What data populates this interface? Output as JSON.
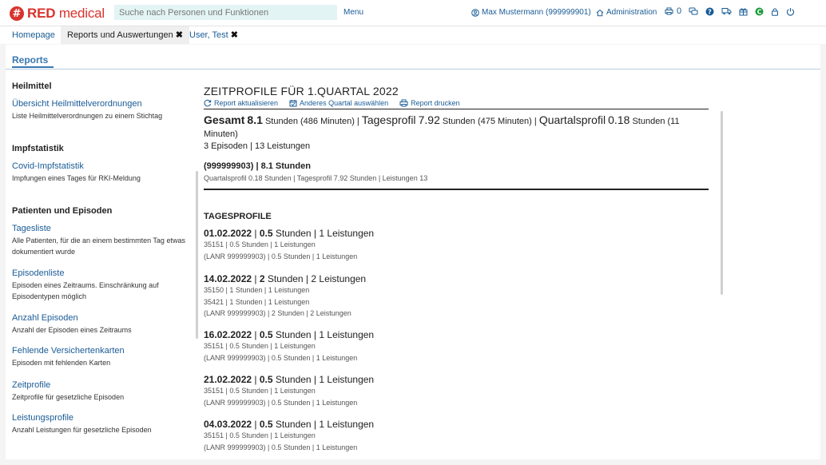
{
  "brand": {
    "mark": "#",
    "name_bold": "RED",
    "name_rest": " medical"
  },
  "topbar": {
    "search_placeholder": "Suche nach Personen und Funktionen",
    "menu": "Menu",
    "user": "Max Mustermann (999999901)",
    "admin": "Administration",
    "print_count": "0"
  },
  "tabs": [
    {
      "label": "Homepage"
    },
    {
      "label": "Reports und Auswertungen",
      "close": "✖"
    },
    {
      "label": "User, Test",
      "close": "✖"
    }
  ],
  "section": {
    "title": "Reports"
  },
  "sidebar": {
    "groups": [
      "Heilmittel",
      "Impfstatistik",
      "Patienten und Episoden"
    ],
    "items": [
      {
        "title": "Übersicht Heilmittelverordnungen",
        "desc": "Liste Heilmittelverordnungen zu einem Stichtag"
      },
      {
        "title": "Covid-Impfstatistik",
        "desc": "Impfungen eines Tages für RKI-Meldung"
      },
      {
        "title": "Tagesliste",
        "desc": "Alle Patienten, für die an einem bestimmten Tag etwas dokumentiert wurde"
      },
      {
        "title": "Episodenliste",
        "desc": "Episoden eines Zeitraums. Einschränkung auf Episodentypen möglich"
      },
      {
        "title": "Anzahl Episoden",
        "desc": "Anzahl der Episoden eines Zeitraums"
      },
      {
        "title": "Fehlende Versichertenkarten",
        "desc": "Episoden mit fehlenden Karten"
      },
      {
        "title": "Zeitprofile",
        "desc": "Zeitprofile für gesetzliche Episoden"
      },
      {
        "title": "Leistungsprofile",
        "desc": "Anzahl Leistungen für gesetzliche Episoden"
      }
    ]
  },
  "report": {
    "title": "ZEITPROFILE FÜR 1.QUARTAL 2022",
    "actions": {
      "refresh": "Report aktualisieren",
      "quarter": "Anderes Quartal auswählen",
      "print": "Report drucken"
    },
    "summary": {
      "total_label": "Gesamt",
      "total_value": "8.1",
      "total_unit": "Stunden (486 Minuten) |",
      "day_label": "Tagesprofil",
      "day_value": "7.92",
      "day_unit": "Stunden (475 Minuten) |",
      "quarter_label": "Quartalsprofil",
      "quarter_value": "0.18",
      "quarter_unit": "Stunden (11 Minuten)"
    },
    "episodes": "3 Episoden | 13 Leistungen",
    "lanr_head": "(999999903) | 8.1 Stunden",
    "lanr_sub": "Quartalsprofil 0.18 Stunden | Tagesprofil 7.92 Stunden | Leistungen 13",
    "tagesprofile_head": "TAGESPROFILE",
    "days": [
      {
        "date": "01.02.2022",
        "hours": "0.5",
        "rest": "Stunden | 1 Leistungen",
        "lines": [
          "35151 | 0.5 Stunden | 1 Leistungen",
          "(LANR 999999903) | 0.5 Stunden | 1 Leistungen"
        ]
      },
      {
        "date": "14.02.2022",
        "hours": "2",
        "rest": "Stunden | 2 Leistungen",
        "lines": [
          "35150 | 1 Stunden | 1 Leistungen",
          "35421 | 1 Stunden | 1 Leistungen",
          "(LANR 999999903) | 2 Stunden | 2 Leistungen"
        ]
      },
      {
        "date": "16.02.2022",
        "hours": "0.5",
        "rest": "Stunden | 1 Leistungen",
        "lines": [
          "35151 | 0.5 Stunden | 1 Leistungen",
          "(LANR 999999903) | 0.5 Stunden | 1 Leistungen"
        ]
      },
      {
        "date": "21.02.2022",
        "hours": "0.5",
        "rest": "Stunden | 1 Leistungen",
        "lines": [
          "35151 | 0.5 Stunden | 1 Leistungen",
          "(LANR 999999903) | 0.5 Stunden | 1 Leistungen"
        ]
      },
      {
        "date": "04.03.2022",
        "hours": "0.5",
        "rest": "Stunden | 1 Leistungen",
        "lines": [
          "35151 | 0.5 Stunden | 1 Leistungen",
          "(LANR 999999903) | 0.5 Stunden | 1 Leistungen"
        ]
      }
    ]
  }
}
